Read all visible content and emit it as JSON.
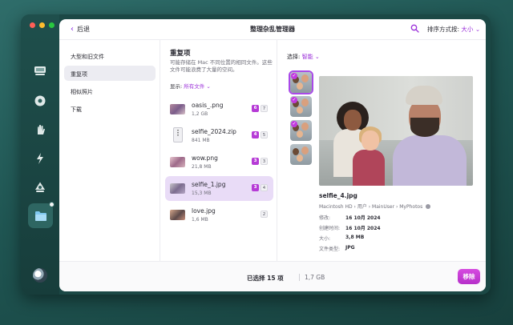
{
  "window": {
    "title": "整理杂乱管理器",
    "back_label": "后退",
    "sort_label": "排序方式按:",
    "sort_value": "大小"
  },
  "sidebar": {
    "icons": [
      "cleanup-icon",
      "protection-icon",
      "performance-icon",
      "applications-icon",
      "clutter-icon",
      "my-clutter-icon"
    ],
    "assistant": "assistant-icon"
  },
  "categories": [
    {
      "label": "大型和旧文件"
    },
    {
      "label": "重复项"
    },
    {
      "label": "相似照片"
    },
    {
      "label": "下载"
    }
  ],
  "duplicates": {
    "title": "重复项",
    "description": "可能存储在 Mac 不同位置的相同文件。这些文件可能浪费了大量的空间。",
    "show_label": "显示:",
    "show_value": "所有文件",
    "files": [
      {
        "name": "oasis_.png",
        "size": "1,2 GB",
        "selected": "6",
        "total": "7"
      },
      {
        "name": "selfie_2024.zip",
        "size": "841 MB",
        "selected": "4",
        "total": "5"
      },
      {
        "name": "wow.png",
        "size": "21,8 MB",
        "selected": "3",
        "total": "3"
      },
      {
        "name": "selfie_1.jpg",
        "size": "15,3 MB",
        "selected": "3",
        "total": "4"
      },
      {
        "name": "love.jpg",
        "size": "1,6 MB",
        "selected": "",
        "total": "2"
      }
    ]
  },
  "preview": {
    "select_label": "选择:",
    "select_value": "智能",
    "file_name": "selfie_4.jpg",
    "path": "Macintosh HD › 用户 › MainUser › MyPhotos",
    "details": [
      {
        "label": "修改:",
        "value": "16 10月 2024"
      },
      {
        "label": "创建时间:",
        "value": "16 10月 2024"
      },
      {
        "label": "大小:",
        "value": "3,8 MB"
      },
      {
        "label": "文件类型:",
        "value": "JPG"
      }
    ]
  },
  "footer": {
    "selected_label": "已选择 15 项",
    "selected_size": "1,7 GB",
    "move_button": "移除"
  },
  "colors": {
    "accent": "#9b30d9",
    "button": "#c23be0",
    "sidebar": "#1f4f4c"
  }
}
